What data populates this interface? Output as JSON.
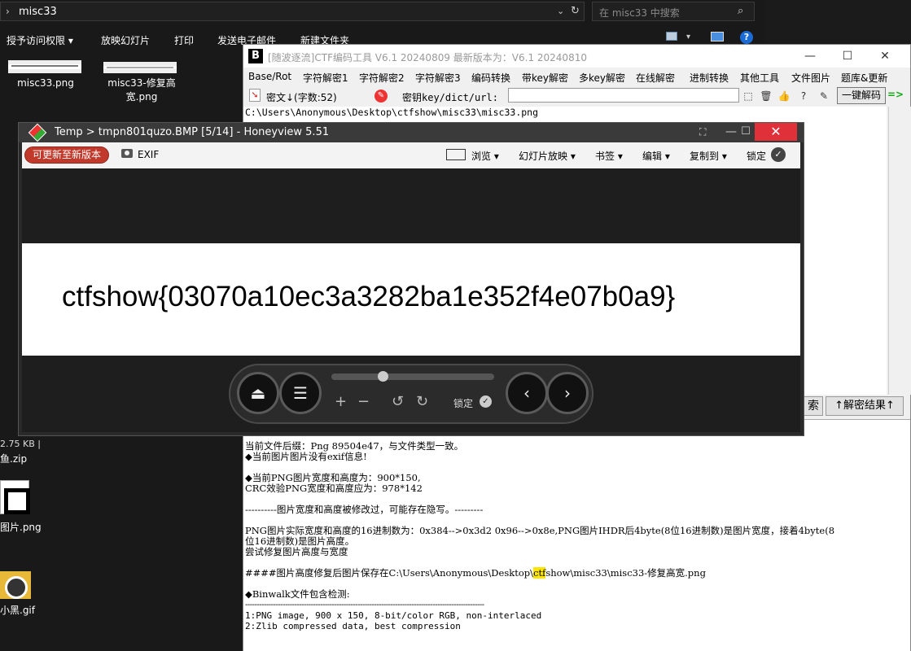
{
  "explorer": {
    "path": "misc33",
    "search_placeholder": "在 misc33 中搜索",
    "ribbon": [
      "授予访问权限",
      "放映幻灯片",
      "打印",
      "发送电子邮件",
      "新建文件夹"
    ],
    "files": [
      "misc33.png",
      "misc33-修复高宽.png"
    ],
    "status_size": "2.75 KB",
    "desktop_items": [
      "鱼.zip",
      "图片.png",
      "小黑.gif"
    ]
  },
  "ctf": {
    "title": "[随波逐流]CTF编码工具 V6.1 20240809    最新版本为：V6.1 20240810",
    "menu": [
      "Base/Rot",
      "字符解密1",
      "字符解密2",
      "字符解密3",
      "编码转换",
      "带key解密",
      "多key解密",
      "在线解密",
      "进制转换",
      "其他工具",
      "文件图片",
      "题库&更新"
    ],
    "cipher_label": "密文↓(字数:52)",
    "key_label": "密钥key/dict/url:",
    "key_value": "",
    "decode_button": "一键解码",
    "arrow": "=>",
    "path_line": "C:\\Users\\Anonymous\\Desktop\\ctfshow\\misc33\\misc33.png",
    "search_part_button": "索",
    "decrypt_result_button": "↑解密结果↑",
    "output_lines": [
      "当前文件后缀：Png  89504e47，与文件类型一致。",
      "◆当前图片图片没有exif信息!",
      "",
      "◆当前PNG图片宽度和高度为：900*150,",
      "CRC效验PNG宽度和高度应为：978*142",
      "",
      "----------图片宽度和高度被修改过，可能存在隐写。---------",
      "",
      "PNG图片实际宽度和高度的16进制数为：0x384-->0x3d2 0x96-->0x8e,PNG图片IHDR后4byte(8位16进制数)是图片宽度，接着4byte(8",
      "位16进制数)是图片高度。",
      "尝试修复图片高度与宽度",
      "",
      "####图片高度修复后图片保存在C:\\Users\\Anonymous\\Desktop\\",
      "",
      "◆Binwalk文件包含检测:",
      "------------------------------------------------------------------------------------------------------",
      "1:PNG image, 900 x 150, 8-bit/color RGB, non-interlaced",
      "2:Zlib compressed data, best compression"
    ],
    "save_path_highlight": "ctf",
    "save_path_rest": "show\\misc33\\misc33-修复高宽.png"
  },
  "honeyview": {
    "title": "Temp > tmpn801quzo.BMP [5/14] - Honeyview 5.51",
    "update_button": "可更新至新版本",
    "exif": "EXIF",
    "menu": [
      "浏览",
      "幻灯片放映",
      "书签",
      "编辑",
      "复制到",
      "锁定"
    ],
    "image_text": "ctfshow{03070a10ec3a3282ba1e352f4e07b0a9}",
    "lock_label": "锁定"
  }
}
